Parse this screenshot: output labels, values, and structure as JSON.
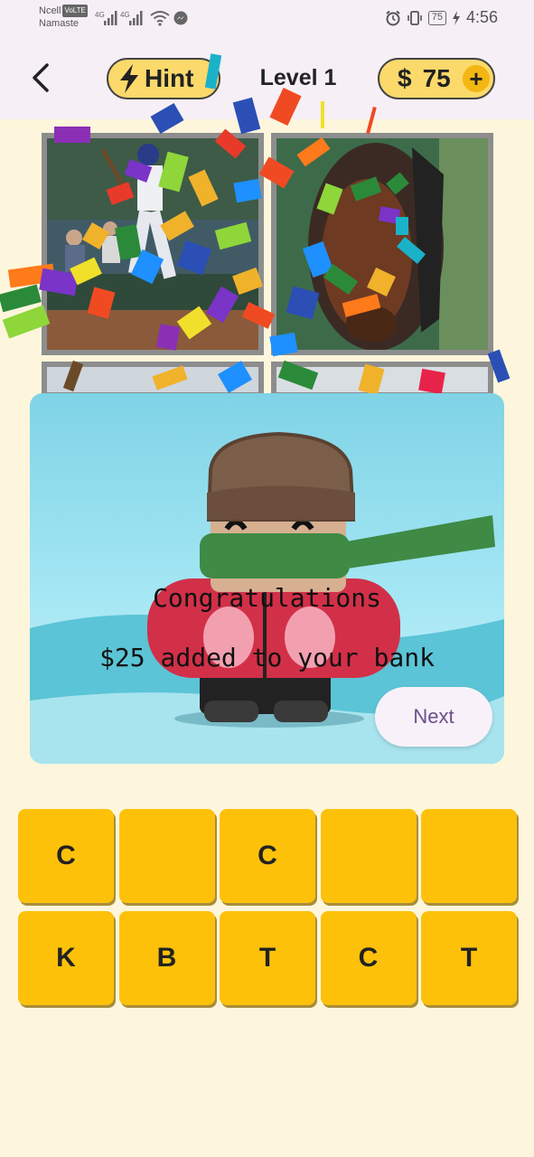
{
  "status": {
    "carrier_line1": "Ncell",
    "volte_badge": "VoLTE",
    "carrier_line2": "Namaste",
    "network_a": "4G",
    "network_b": "4G",
    "battery": "75",
    "time": "4:56"
  },
  "header": {
    "hint_label": "Hint",
    "level_label": "Level 1",
    "currency_symbol": "$",
    "coins": "75",
    "add_label": "+"
  },
  "modal": {
    "title": "Congratulations",
    "message": "$25 added to your bank",
    "next_label": "Next"
  },
  "tiles": [
    {
      "letter": "C"
    },
    {
      "letter": ""
    },
    {
      "letter": "C"
    },
    {
      "letter": ""
    },
    {
      "letter": ""
    },
    {
      "letter": "K"
    },
    {
      "letter": "B"
    },
    {
      "letter": "T"
    },
    {
      "letter": "C"
    },
    {
      "letter": "T"
    }
  ],
  "colors": {
    "background": "#fdf6dc",
    "pill": "#fbd96b",
    "tile": "#fdc10a",
    "next_text": "#6b4f8a"
  }
}
